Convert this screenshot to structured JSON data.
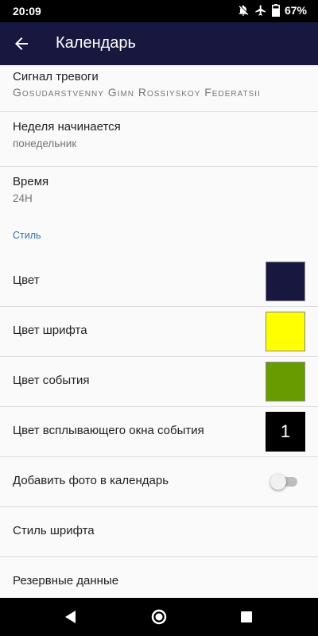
{
  "status_bar": {
    "time": "20:09",
    "battery": "67%",
    "icons": [
      "notifications-off-icon",
      "airplane-icon",
      "battery-icon"
    ]
  },
  "app_bar": {
    "title": "Календарь",
    "back_icon": "arrow-back-icon",
    "background": "#171740"
  },
  "settings": {
    "alarm": {
      "title": "Сигнал тревоги",
      "value": "Gosudarstvenny Gimn Rossiyskoy Federatsii"
    },
    "week_start": {
      "title": "Неделя начинается",
      "value": "понедельник"
    },
    "time_format": {
      "title": "Время",
      "value": "24H"
    },
    "style_category": "Стиль",
    "color": {
      "title": "Цвет",
      "swatch": "#171740"
    },
    "font_color": {
      "title": "Цвет шрифта",
      "swatch": "#ffff00"
    },
    "event_color": {
      "title": "Цвет события",
      "swatch": "#669c00"
    },
    "popup_color": {
      "title": "Цвет всплывающего окна события",
      "swatch": "#000000",
      "swatch_text": "1"
    },
    "add_photo": {
      "title": "Добавить фото в календарь",
      "enabled": false
    },
    "font_style": {
      "title": "Стиль шрифта"
    },
    "backup": {
      "title": "Резервные данные"
    }
  },
  "nav_bar": {
    "icons": [
      "back-triangle-icon",
      "home-circle-icon",
      "recents-square-icon"
    ]
  }
}
